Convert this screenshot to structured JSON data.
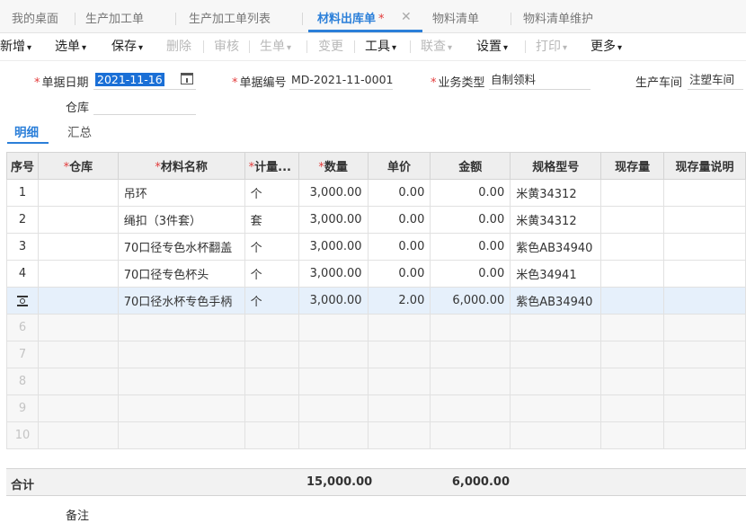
{
  "tabs": [
    {
      "label": "我的桌面"
    },
    {
      "label": "生产加工单"
    },
    {
      "label": "生产加工单列表"
    },
    {
      "label": "材料出库单",
      "mark": "*",
      "active": true
    },
    {
      "label": "物料清单"
    },
    {
      "label": "物料清单维护"
    }
  ],
  "toolbar": {
    "add": "新增",
    "select": "选单",
    "save": "保存",
    "delete": "删除",
    "audit": "审核",
    "generate": "生单",
    "change": "变更",
    "tools": "工具",
    "query": "联查",
    "settings": "设置",
    "print": "打印",
    "more": "更多"
  },
  "form": {
    "date_label": "单据日期",
    "date_value": "2021-11-16",
    "number_label": "单据编号",
    "number_value": "MD-2021-11-0001",
    "biz_type_label": "业务类型",
    "biz_type_value": "自制领料",
    "workshop_label": "生产车间",
    "workshop_value": "注塑车间",
    "warehouse_label": "仓库",
    "warehouse_value": ""
  },
  "subtabs": {
    "detail": "明细",
    "summary": "汇总"
  },
  "grid": {
    "headers": {
      "seq": "序号",
      "warehouse": "仓库",
      "material": "材料名称",
      "unit": "计量...",
      "qty": "数量",
      "price": "单价",
      "amount": "金额",
      "spec": "规格型号",
      "stock": "现存量",
      "stock_note": "现存量说明"
    },
    "rows": [
      {
        "seq": "1",
        "material": "吊环",
        "unit": "个",
        "qty": "3,000.00",
        "price": "0.00",
        "amount": "0.00",
        "spec": "米黄34312"
      },
      {
        "seq": "2",
        "material": "绳扣（3件套）",
        "unit": "套",
        "qty": "3,000.00",
        "price": "0.00",
        "amount": "0.00",
        "spec": "米黄34312"
      },
      {
        "seq": "3",
        "material": "70口径专色水杯翻盖",
        "unit": "个",
        "qty": "3,000.00",
        "price": "0.00",
        "amount": "0.00",
        "spec": "紫色AB34940"
      },
      {
        "seq": "4",
        "material": "70口径专色杯头",
        "unit": "个",
        "qty": "3,000.00",
        "price": "0.00",
        "amount": "0.00",
        "spec": "米色34941"
      },
      {
        "seq": "",
        "material": "70口径水杯专色手柄",
        "unit": "个",
        "qty": "3,000.00",
        "price": "2.00",
        "amount": "6,000.00",
        "spec": "紫色AB34940"
      }
    ],
    "empty_rows": [
      "6",
      "7",
      "8",
      "9",
      "10"
    ]
  },
  "totals": {
    "label": "合计",
    "qty": "15,000.00",
    "amount": "6,000.00"
  },
  "remark_label": "备注"
}
